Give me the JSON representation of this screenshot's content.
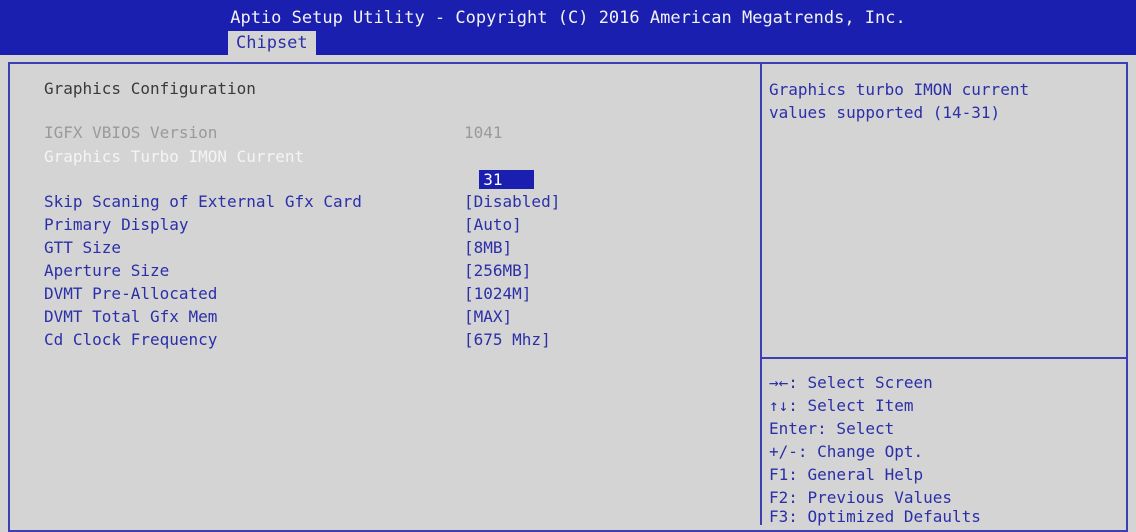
{
  "header": {
    "title": "Aptio Setup Utility - Copyright (C) 2016 American Megatrends, Inc.",
    "active_tab": "Chipset"
  },
  "main": {
    "section_title": "Graphics Configuration",
    "info": {
      "label": "IGFX VBIOS Version",
      "value": "1041"
    },
    "selected_item": {
      "label": "Graphics Turbo IMON Current",
      "value": "31"
    },
    "settings": [
      {
        "label": "Skip Scaning of External Gfx Card",
        "value": "[Disabled]"
      },
      {
        "label": "Primary Display",
        "value": "[Auto]"
      },
      {
        "label": "GTT Size",
        "value": "[8MB]"
      },
      {
        "label": "Aperture Size",
        "value": "[256MB]"
      },
      {
        "label": "DVMT Pre-Allocated",
        "value": "[1024M]"
      },
      {
        "label": "DVMT Total Gfx Mem",
        "value": "[MAX]"
      },
      {
        "label": "Cd Clock Frequency",
        "value": "[675 Mhz]"
      }
    ]
  },
  "help": {
    "line1": "Graphics turbo IMON current",
    "line2": "values supported (14-31)"
  },
  "keys": [
    "→←: Select Screen",
    "↑↓: Select Item",
    "Enter: Select",
    "+/-: Change Opt.",
    "F1: General Help",
    "F2: Previous Values",
    "F3: Optimized Defaults"
  ],
  "colors": {
    "title_bar": "#1a1fb0",
    "background": "#d4d4d4",
    "text_blue": "#2b2fa8",
    "selection_bg": "#1a1fb0"
  }
}
